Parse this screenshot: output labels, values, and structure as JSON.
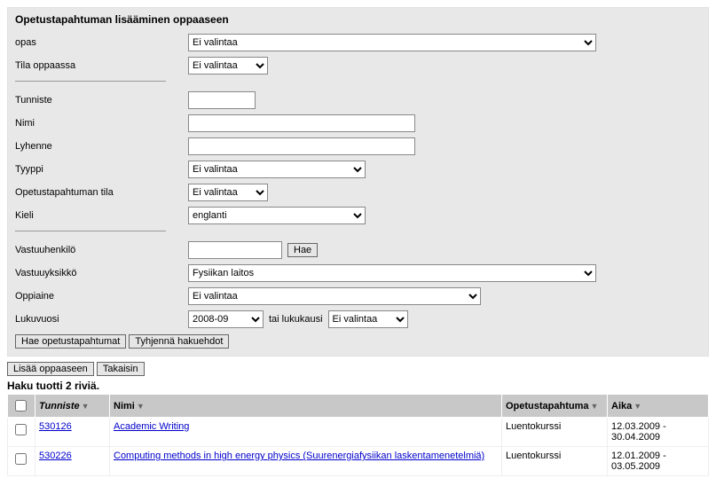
{
  "form": {
    "title": "Opetustapahtuman lisääminen oppaaseen",
    "opas": {
      "label": "opas",
      "value": "Ei valintaa"
    },
    "tila_oppaassa": {
      "label": "Tila oppaassa",
      "value": "Ei valintaa"
    },
    "tunniste": {
      "label": "Tunniste",
      "value": ""
    },
    "nimi": {
      "label": "Nimi",
      "value": ""
    },
    "lyhenne": {
      "label": "Lyhenne",
      "value": ""
    },
    "tyyppi": {
      "label": "Tyyppi",
      "value": "Ei valintaa"
    },
    "opetustapahtuman_tila": {
      "label": "Opetustapahtuman tila",
      "value": "Ei valintaa"
    },
    "kieli": {
      "label": "Kieli",
      "value": "englanti"
    },
    "vastuuhenkilo": {
      "label": "Vastuuhenkilö",
      "value": "",
      "hae": "Hae"
    },
    "vastuuyksikko": {
      "label": "Vastuuyksikkö",
      "value": "Fysiikan laitos"
    },
    "oppiaine": {
      "label": "Oppiaine",
      "value": "Ei valintaa"
    },
    "lukuvuosi": {
      "label": "Lukuvuosi",
      "value": "2008-09",
      "tai_label": "tai lukukausi",
      "lukukausi_value": "Ei valintaa"
    },
    "buttons": {
      "hae": "Hae opetustapahtumat",
      "tyhjenna": "Tyhjennä hakuehdot"
    }
  },
  "outer_buttons": {
    "lisaa": "Lisää oppaaseen",
    "takaisin": "Takaisin"
  },
  "results": {
    "summary": "Haku tuotti 2 riviä.",
    "headers": {
      "tunniste": "Tunniste",
      "nimi": "Nimi",
      "opetustapahtuma": "Opetustapahtuma",
      "aika": "Aika"
    },
    "rows": [
      {
        "tunniste": "530126",
        "nimi": "Academic Writing",
        "tyyppi": "Luentokurssi",
        "aika": "12.03.2009 - 30.04.2009"
      },
      {
        "tunniste": "530226",
        "nimi": "Computing methods in high energy physics (Suurenergiafysiikan laskentamenetelmiä)",
        "tyyppi": "Luentokurssi",
        "aika": "12.01.2009 - 03.05.2009"
      }
    ]
  }
}
